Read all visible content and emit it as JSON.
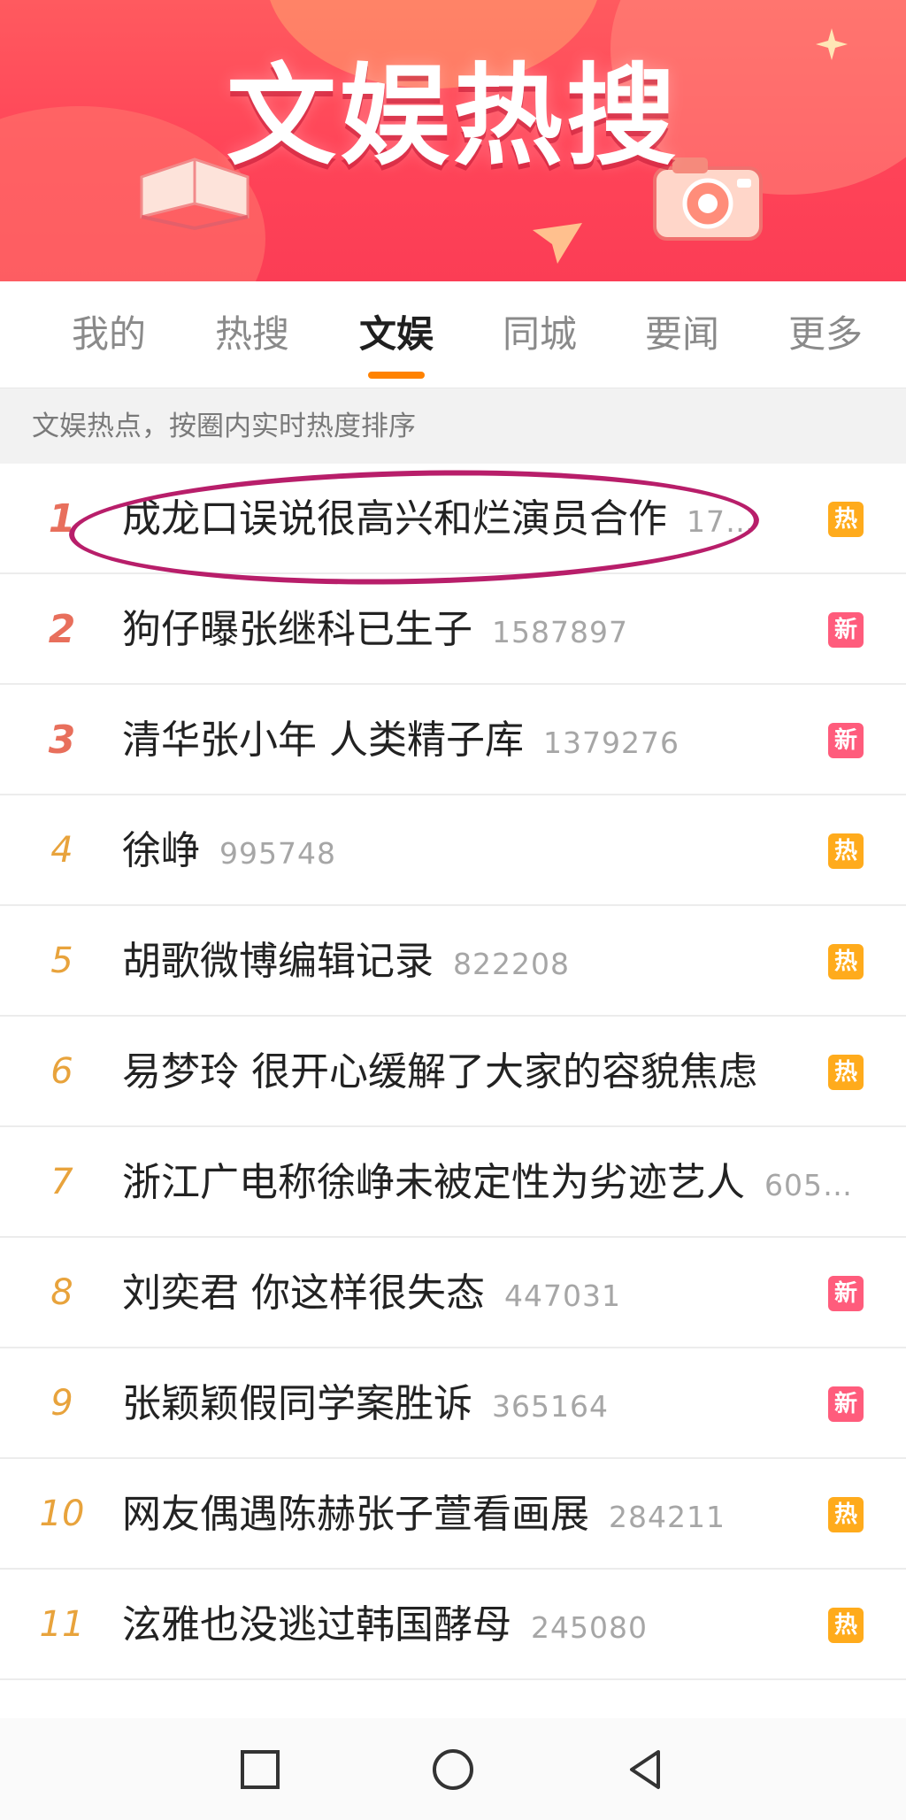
{
  "banner": {
    "title": "文娱热搜"
  },
  "tabs": [
    {
      "label": "我的"
    },
    {
      "label": "热搜"
    },
    {
      "label": "文娱"
    },
    {
      "label": "同城"
    },
    {
      "label": "要闻"
    },
    {
      "label": "更多"
    }
  ],
  "active_tab": "文娱",
  "section_note": "文娱热点，按圈内实时热度排序",
  "rows": [
    {
      "rank": "1",
      "topic": "成龙口误说很高兴和烂演员合作",
      "count": "17…",
      "badge": "热"
    },
    {
      "rank": "2",
      "topic": "狗仔曝张继科已生子",
      "count": "1587897",
      "badge": "新"
    },
    {
      "rank": "3",
      "topic": "清华张小年 人类精子库",
      "count": "1379276",
      "badge": "新"
    },
    {
      "rank": "4",
      "topic": "徐峥",
      "count": "995748",
      "badge": "热"
    },
    {
      "rank": "5",
      "topic": "胡歌微博编辑记录",
      "count": "822208",
      "badge": "热"
    },
    {
      "rank": "6",
      "topic": "易梦玲 很开心缓解了大家的容貌焦虑",
      "count": "",
      "badge": "热"
    },
    {
      "rank": "7",
      "topic": "浙江广电称徐峥未被定性为劣迹艺人",
      "count": "605…",
      "badge": ""
    },
    {
      "rank": "8",
      "topic": "刘奕君 你这样很失态",
      "count": "447031",
      "badge": "新"
    },
    {
      "rank": "9",
      "topic": "张颖颖假同学案胜诉",
      "count": "365164",
      "badge": "新"
    },
    {
      "rank": "10",
      "topic": "网友偶遇陈赫张子萱看画展",
      "count": "284211",
      "badge": "热"
    },
    {
      "rank": "11",
      "topic": "泫雅也没逃过韩国酵母",
      "count": "245080",
      "badge": "热"
    }
  ],
  "colors": {
    "accent": "#ff8200",
    "banner": "#ff4458",
    "hot_badge": "#ffab1c",
    "new_badge": "#ff5c7c",
    "rank_top": "#e86f5c",
    "rank_other": "#e8a33c",
    "annotation": "#b81e6a"
  },
  "icons": {
    "nav_recent": "square-icon",
    "nav_home": "circle-icon",
    "nav_back": "triangle-back-icon"
  }
}
